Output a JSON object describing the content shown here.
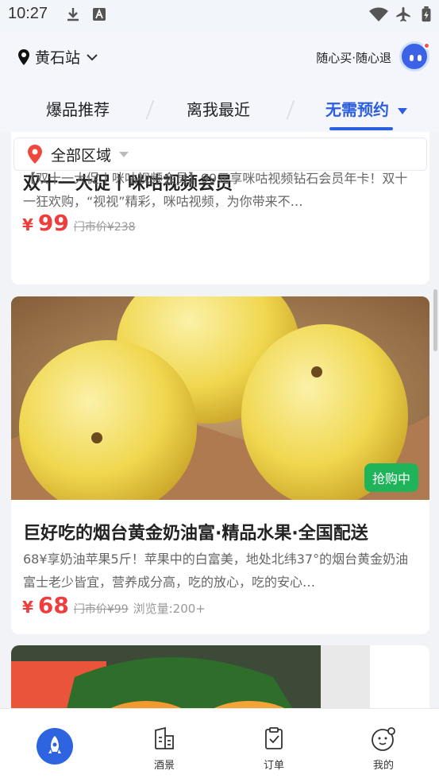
{
  "status_bar": {
    "time": "10:27"
  },
  "header": {
    "location": "黄石站",
    "slogan": "随心买·随心退"
  },
  "tabs": [
    {
      "label": "爆品推荐"
    },
    {
      "label": "离我最近"
    },
    {
      "label": "无需预约"
    }
  ],
  "filter": {
    "region": "全部区域"
  },
  "cards": [
    {
      "title": "双十一大促丨咪咕视频会员",
      "desc": "【双十一大促丨咪咕视频会员】99元享咪咕视频钻石会员年卡！双十一狂欢购，“视视”精彩，咪咕视频，为你带来不…",
      "currency": "¥",
      "price": "99",
      "original_price": "门市价¥238"
    },
    {
      "title": "巨好吃的烟台黄金奶油富·精品水果·全国配送",
      "desc": "68¥享奶油苹果5斤！苹果中的白富美，地处北纬37°的烟台黄金奶油富士老少皆宜，营养成分高，吃的放心，吃的安心…",
      "currency": "¥",
      "price": "68",
      "original_price": "门市价¥99",
      "views": "浏览量:200+",
      "badge": "抢购中"
    }
  ],
  "bottom_nav": [
    {
      "label": "",
      "icon": "rocket-icon"
    },
    {
      "label": "酒景",
      "icon": "building-icon"
    },
    {
      "label": "订单",
      "icon": "clipboard-icon"
    },
    {
      "label": "我的",
      "icon": "smiley-icon"
    }
  ],
  "colors": {
    "accent": "#2c5fe0",
    "price": "#f03c3c",
    "badge": "#1fb35a"
  }
}
